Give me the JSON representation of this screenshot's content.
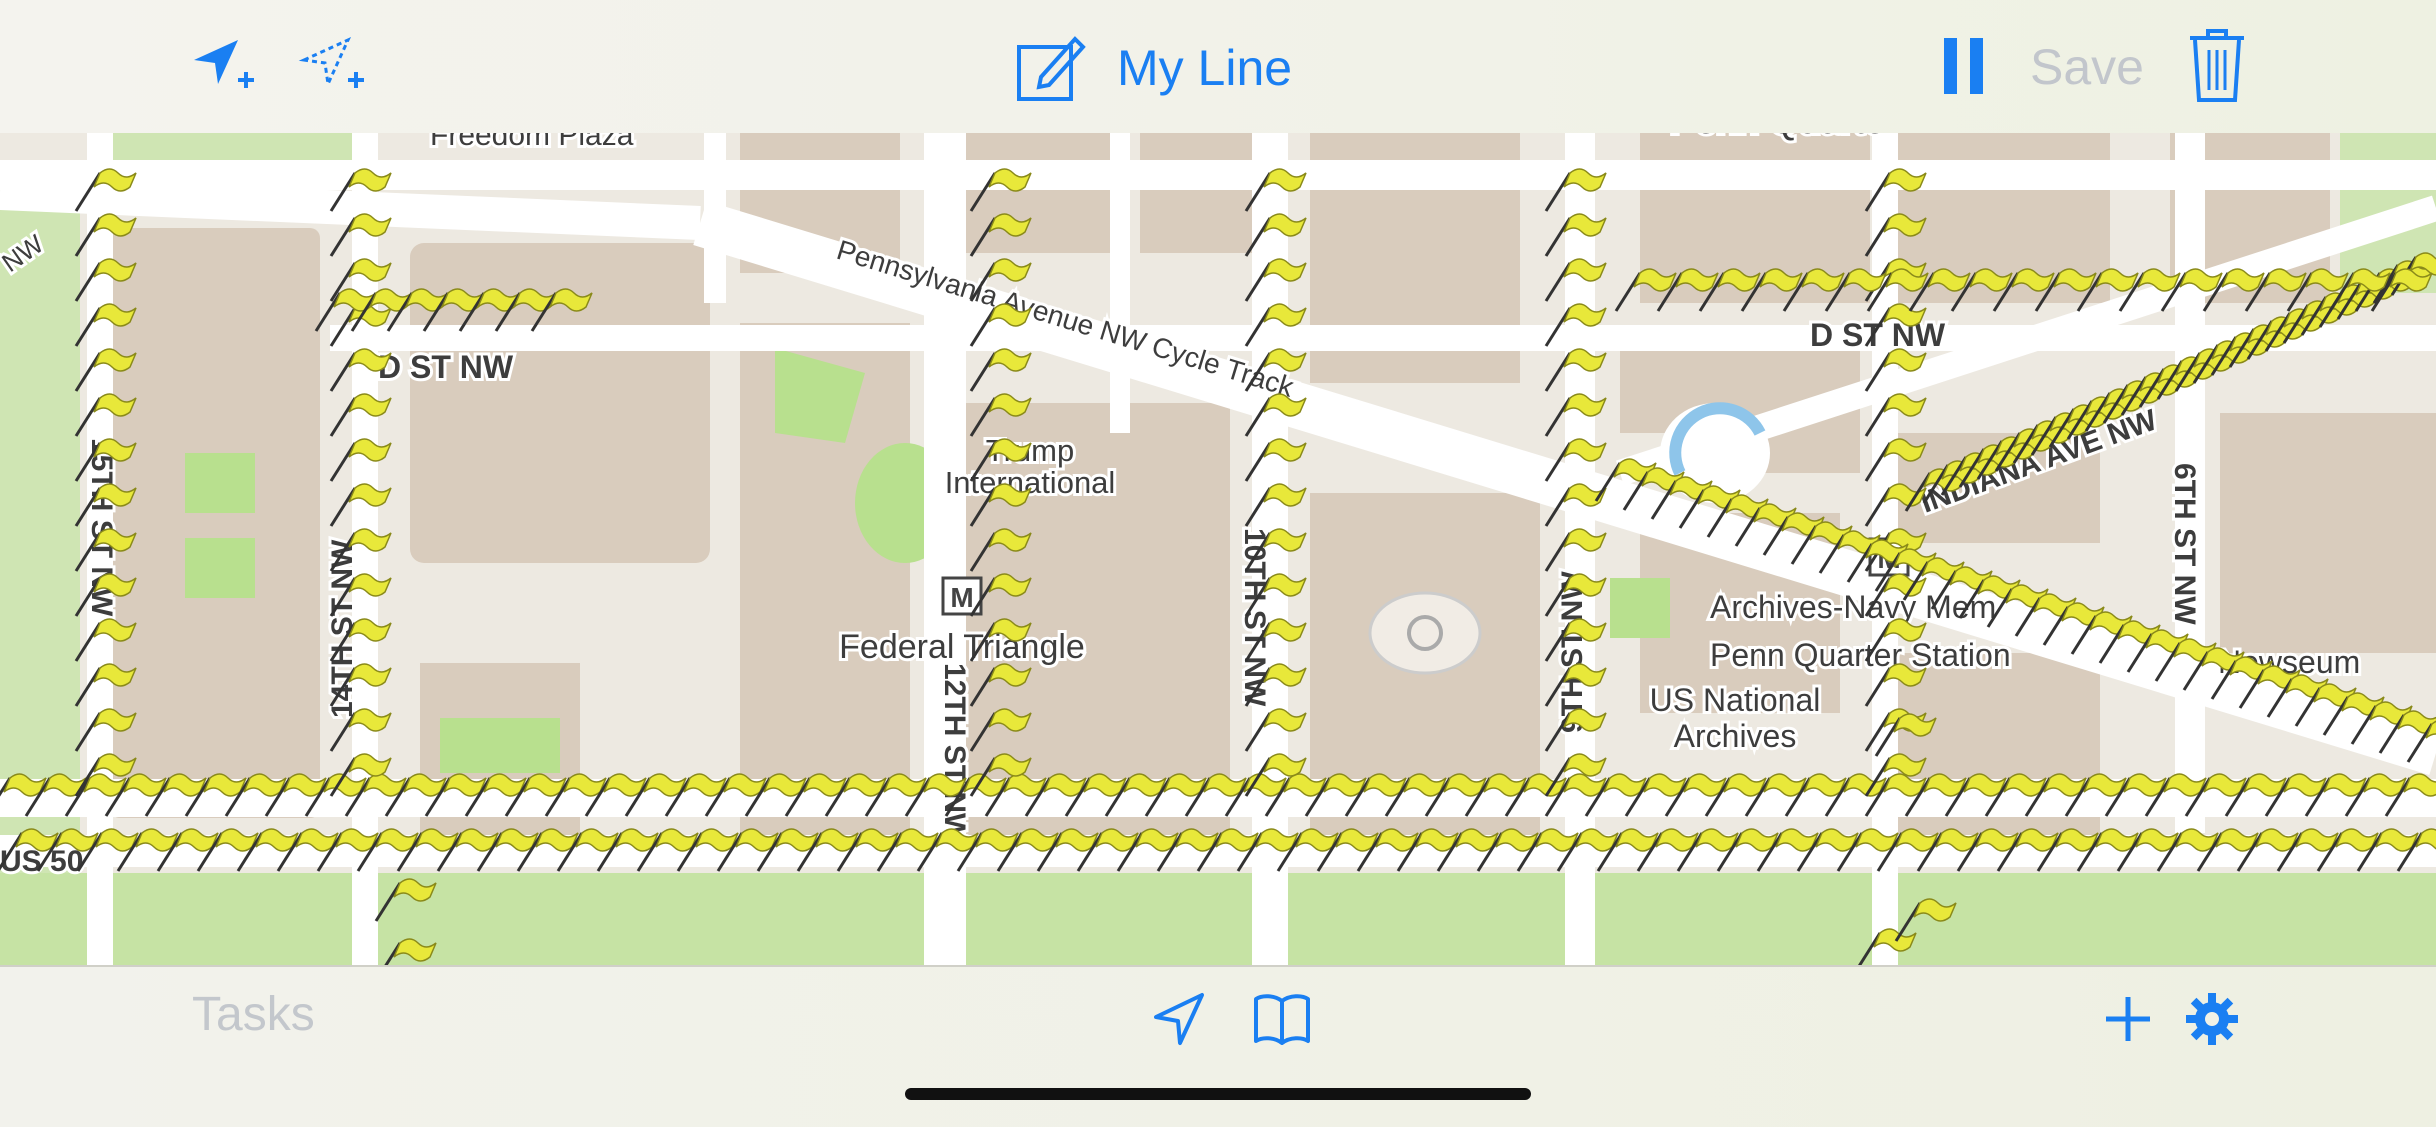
{
  "toolbar": {
    "title": "My Line",
    "save_label": "Save",
    "icons": {
      "add_location": "location-arrow-plus-icon",
      "add_route": "dashed-location-arrow-plus-icon",
      "edit": "compose-icon",
      "pause": "pause-icon",
      "trash": "trash-icon"
    }
  },
  "map": {
    "labels": {
      "freedom_plaza": "Freedom Plaza",
      "penn_quarter_top": "Penn Quarter",
      "d_st_left": "D ST NW",
      "d_st_right": "D ST NW",
      "pennsylvania": "Pennsylvania Avenue NW Cycle Track",
      "trump_1": "Trump",
      "trump_2": "International",
      "federal_triangle": "Federal Triangle",
      "st_15": "15TH ST NW",
      "st_14": "14TH ST NW",
      "st_12": "12TH ST NW",
      "st_10": "10TH ST NW",
      "st_9": "9TH ST NW",
      "st_6": "6TH ST NW",
      "indiana": "INDIANA AVE NW",
      "archives_navy": "Archives-Navy Mem",
      "penn_quarter_station": "Penn Quarter Station",
      "us_national_1": "US National",
      "us_national_2": "Archives",
      "newseum": "Newseum",
      "nw": "NW",
      "us50": "US 50",
      "metro": "M"
    },
    "colors": {
      "flag": "#e8e83a",
      "road": "#ffffff",
      "block": "#d9ccbd",
      "park": "#c6e3a4"
    }
  },
  "bottombar": {
    "tasks_label": "Tasks",
    "icons": {
      "locate": "location-arrow-icon",
      "bookmarks": "book-icon",
      "add": "plus-icon",
      "settings": "gear-icon"
    }
  },
  "accent_color": "#1a7ff2"
}
